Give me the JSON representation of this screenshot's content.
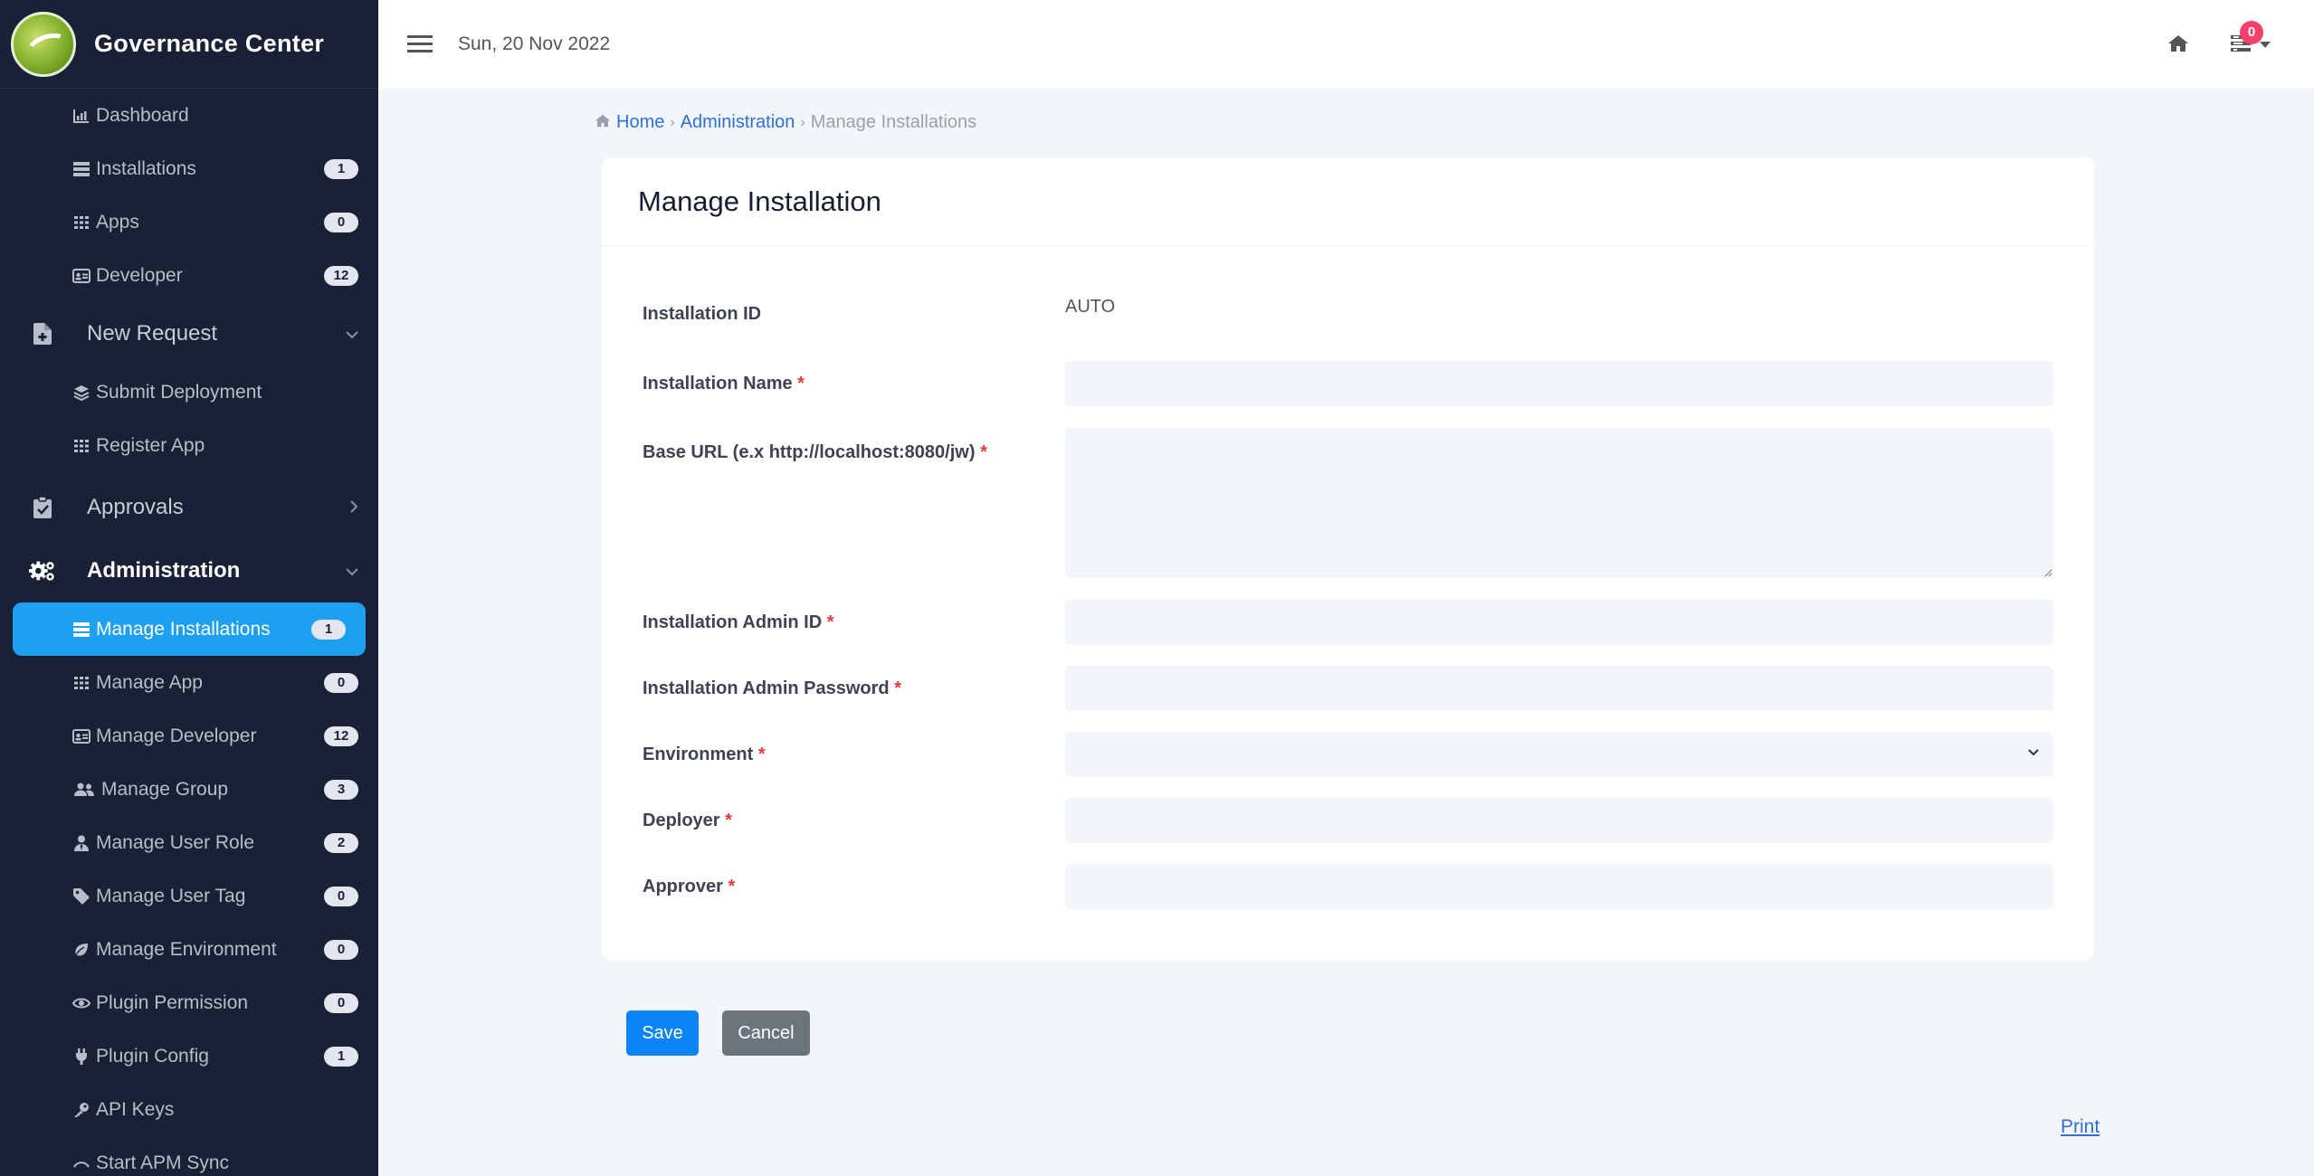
{
  "app": {
    "title": "Governance Center"
  },
  "topbar": {
    "date": "Sun, 20 Nov 2022",
    "notification_count": "0"
  },
  "sidebar": {
    "top_items": [
      {
        "label": "Dashboard",
        "icon": "bar-chart-icon",
        "badge": null
      },
      {
        "label": "Installations",
        "icon": "server-icon",
        "badge": "1"
      },
      {
        "label": "Apps",
        "icon": "grid-icon",
        "badge": "0"
      },
      {
        "label": "Developer",
        "icon": "id-card-icon",
        "badge": "12"
      }
    ],
    "sections": {
      "new_request": {
        "label": "New Request",
        "items": [
          {
            "label": "Submit Deployment",
            "icon": "layers-icon"
          },
          {
            "label": "Register App",
            "icon": "grid-icon"
          }
        ]
      },
      "approvals": {
        "label": "Approvals"
      },
      "administration": {
        "label": "Administration",
        "items": [
          {
            "label": "Manage Installations",
            "icon": "server-icon",
            "badge": "1"
          },
          {
            "label": "Manage App",
            "icon": "grid-icon",
            "badge": "0"
          },
          {
            "label": "Manage Developer",
            "icon": "id-card-icon",
            "badge": "12"
          },
          {
            "label": "Manage Group",
            "icon": "users-icon",
            "badge": "3"
          },
          {
            "label": "Manage User Role",
            "icon": "user-tie-icon",
            "badge": "2"
          },
          {
            "label": "Manage User Tag",
            "icon": "tag-icon",
            "badge": "0"
          },
          {
            "label": "Manage Environment",
            "icon": "leaf-icon",
            "badge": "0"
          },
          {
            "label": "Plugin Permission",
            "icon": "eye-icon",
            "badge": "0"
          },
          {
            "label": "Plugin Config",
            "icon": "plug-icon",
            "badge": "1"
          },
          {
            "label": "API Keys",
            "icon": "key-icon",
            "badge": null
          },
          {
            "label": "Start APM Sync",
            "icon": "sync-icon",
            "badge": null
          }
        ]
      }
    }
  },
  "breadcrumb": {
    "home": "Home",
    "parent": "Administration",
    "current": "Manage Installations"
  },
  "form": {
    "title": "Manage Installation",
    "fields": {
      "installation_id": {
        "label": "Installation ID",
        "value": "AUTO"
      },
      "installation_name": {
        "label": "Installation Name",
        "value": ""
      },
      "base_url": {
        "label": "Base URL (e.x http://localhost:8080/jw)",
        "value": ""
      },
      "admin_id": {
        "label": "Installation Admin ID",
        "value": ""
      },
      "admin_password": {
        "label": "Installation Admin Password",
        "value": ""
      },
      "environment": {
        "label": "Environment",
        "value": ""
      },
      "deployer": {
        "label": "Deployer",
        "value": ""
      },
      "approver": {
        "label": "Approver",
        "value": ""
      }
    },
    "required_marker": "*",
    "save_label": "Save",
    "cancel_label": "Cancel"
  },
  "footer": {
    "print_label": "Print"
  },
  "colors": {
    "sidebar_bg": "#1a2035",
    "active_item": "#1ea0f0",
    "primary": "#0d84f5",
    "secondary": "#6c757d",
    "badge_alert": "#f1416c"
  }
}
